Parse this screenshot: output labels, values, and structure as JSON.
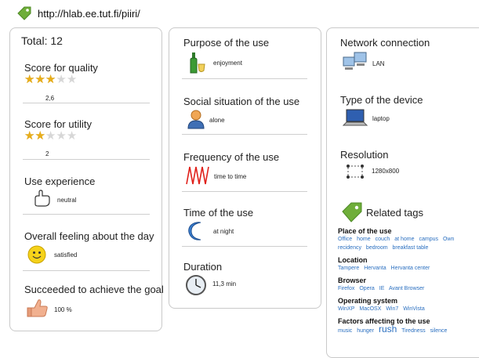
{
  "url": "http://hlab.ee.tut.fi/piiri/",
  "col1": {
    "total": "Total: 12",
    "quality_title": "Score for quality",
    "quality_rating": 2.6,
    "quality_value": "2,6",
    "utility_title": "Score for utility",
    "utility_rating": 2,
    "utility_value": "2",
    "experience_title": "Use experience",
    "experience_value": "neutral",
    "feeling_title": "Overall feeling about the day",
    "feeling_value": "satisfied",
    "goal_title": "Succeeded to achieve the goal",
    "goal_value": "100 %"
  },
  "col2": {
    "purpose_title": "Purpose of the use",
    "purpose_value": "enjoyment",
    "social_title": "Social situation of the use",
    "social_value": "alone",
    "frequency_title": "Frequency of the use",
    "frequency_value": "time to time",
    "time_title": "Time of the use",
    "time_value": "at night",
    "duration_title": "Duration",
    "duration_value": "11,3 min"
  },
  "col3": {
    "network_title": "Network connection",
    "network_value": "LAN",
    "device_title": "Type of the device",
    "device_value": "laptop",
    "resolution_title": "Resolution",
    "resolution_value": "1280x800",
    "related_title": "Related tags",
    "groups": [
      {
        "heading": "Place of the use",
        "tags": [
          "Office",
          "home",
          "couch",
          "at home",
          "campus",
          "Own",
          "recidency",
          "bedroom",
          "breakfast table"
        ]
      },
      {
        "heading": "Location",
        "tags": [
          "Tampere",
          "Hervanta",
          "Hervanta center"
        ]
      },
      {
        "heading": "Browser",
        "tags": [
          "Firefox",
          "Opera",
          "IE",
          "Avant Browser"
        ]
      },
      {
        "heading": "Operating system",
        "tags": [
          "WinXP",
          "MacOSX",
          "Win7",
          "WinVista"
        ]
      },
      {
        "heading": "Factors affecting to the use",
        "tags": [
          "music",
          "hunger",
          "rush",
          "Tiredness",
          "silence"
        ]
      }
    ]
  },
  "colors": {
    "accent": "#6fae3a",
    "link": "#2a6fc0",
    "border": "#c9c9c9"
  }
}
